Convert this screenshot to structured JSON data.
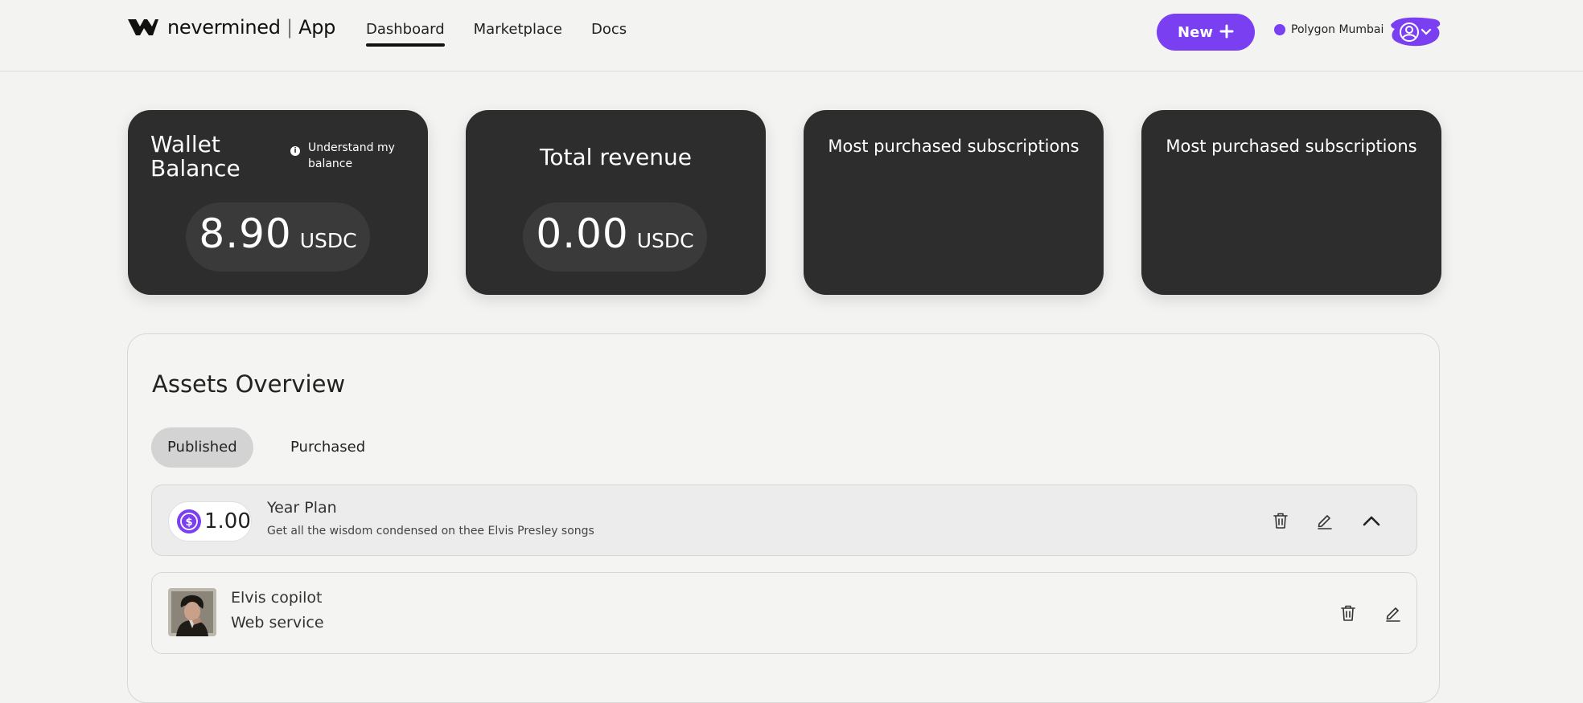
{
  "header": {
    "brand_name": "nevermined",
    "brand_suffix": "App",
    "nav": [
      {
        "label": "Dashboard",
        "active": true
      },
      {
        "label": "Marketplace",
        "active": false
      },
      {
        "label": "Docs",
        "active": false
      }
    ],
    "new_button_label": "New",
    "network_label": "Polygon Mumbai",
    "accent_color": "#7b3ff2"
  },
  "cards": {
    "wallet": {
      "title": "Wallet Balance",
      "info_label": "Understand my balance",
      "amount": "8.90",
      "currency": "USDC"
    },
    "revenue": {
      "title": "Total revenue",
      "amount": "0.00",
      "currency": "USDC"
    },
    "subs1": {
      "title": "Most purchased subscriptions"
    },
    "subs2": {
      "title": "Most purchased subscriptions"
    }
  },
  "assets": {
    "title": "Assets Overview",
    "tabs": [
      {
        "label": "Published",
        "active": true
      },
      {
        "label": "Purchased",
        "active": false
      }
    ],
    "rows": [
      {
        "price": "1.00",
        "title": "Year Plan",
        "description": "Get all the wisdom condensed on thee Elvis Presley songs"
      },
      {
        "title": "Elvis copilot",
        "description": "Web service"
      }
    ]
  },
  "icons": {
    "logo": "nevermined-logo-icon",
    "add": "plus-icon",
    "network": "network-dot-icon",
    "account": "user-circle-icon",
    "dropdown": "chevron-down-icon",
    "info": "info-icon",
    "currency": "usdc-coin-icon",
    "delete": "trash-icon",
    "edit": "pencil-icon",
    "collapse": "chevron-up-icon"
  }
}
